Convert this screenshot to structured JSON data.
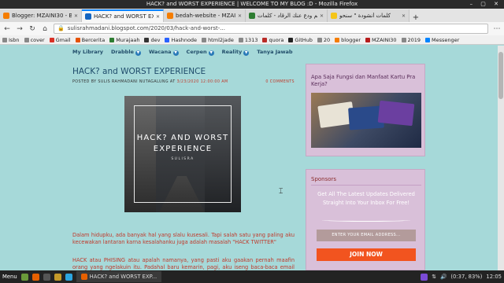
{
  "window": {
    "title": "HACK? and WORST EXPERIENCE | WELCOME TO MY BLOG :D - Mozilla Firefox",
    "controls": "– ▢ ✕"
  },
  "tabs": [
    {
      "label": "Blogger: MZAINI30 - Blo",
      "color": "#f57d00"
    },
    {
      "label": "HACK? and WORST EXP",
      "color": "#1565c0",
      "active": true
    },
    {
      "label": "bedah-website - MZAIN",
      "color": "#f57d00"
    },
    {
      "label": "قم ودع عنك الرقاد - كلمات",
      "color": "#2e7d32"
    },
    {
      "label": "كلمات أنشودة \" سنحو",
      "color": "#f5c518"
    }
  ],
  "nav": {
    "back": "←",
    "forward": "→",
    "reload": "↻",
    "home": "⌂",
    "url": "sulisrahmadani.blogspot.com/2020/03/hack-and-worst-...",
    "menu": "⋯"
  },
  "bookmarks": [
    {
      "label": "Isbn",
      "color": "#888"
    },
    {
      "label": "cover",
      "color": "#888"
    },
    {
      "label": "Gmail",
      "color": "#d93025"
    },
    {
      "label": "Bercerita",
      "color": "#e65100"
    },
    {
      "label": "Murajaah",
      "color": "#2e7d32"
    },
    {
      "label": "dev",
      "color": "#333"
    },
    {
      "label": "Hashnode",
      "color": "#2962ff"
    },
    {
      "label": "html2jade",
      "color": "#888"
    },
    {
      "label": "1313",
      "color": "#888"
    },
    {
      "label": "quora",
      "color": "#b92b27"
    },
    {
      "label": "GitHub",
      "color": "#222"
    },
    {
      "label": "20",
      "color": "#888"
    },
    {
      "label": "blogger",
      "color": "#f57d00"
    },
    {
      "label": "MZAINI30",
      "color": "#b71c1c"
    },
    {
      "label": "2019",
      "color": "#888"
    },
    {
      "label": "Messenger",
      "color": "#0084ff"
    }
  ],
  "blog": {
    "menu": [
      {
        "label": "My Library",
        "dropdown": false
      },
      {
        "label": "Drabble",
        "dropdown": true
      },
      {
        "label": "Wacana",
        "dropdown": true
      },
      {
        "label": "Cerpen",
        "dropdown": true
      },
      {
        "label": "Reality",
        "dropdown": true
      },
      {
        "label": "Tanya Jawab",
        "dropdown": false
      }
    ],
    "dropdown_glyph": "▼",
    "post": {
      "title": "HACK? and WORST EXPERIENCE",
      "meta_author": "POSTED BY SULIS RAHMADANI NUTAGALUNG AT",
      "meta_date": "3/23/2020 12:00:00 AM",
      "comments": "0 COMMENTS",
      "image_line1": "HACK? AND WORST",
      "image_line2": "EXPERIENCE",
      "image_credit": "SULISRA",
      "para1": "Dalam hidupku, ada banyak hal yang slalu kusesali. Tapi salah satu yang paling aku kecewakan lantaran karna kesalahanku juga adalah masalah \"HACK TWITTER\"",
      "para2": "HACK atau PHISING atau apalah namanya, yang pasti aku gaakan pernah maafin orang yang ngelakuin itu. Padahal baru kemarin, pagi, aku iseng baca-baca email dan"
    }
  },
  "sidebar": {
    "card1_title": "Apa Saja Fungsi dan Manfaat Kartu Pra Kerja?",
    "card2_title": "Sponsors",
    "promo": "Get All The Latest Updates Delivered Straight Into Your Inbox For Free!",
    "email_placeholder": "ENTER YOUR EMAIL ADDRESS...",
    "join_label": "JOIN NOW"
  },
  "taskbar": {
    "menu": "Menu",
    "task": "HACK? and WORST EXP...",
    "status": "(0:37, 83%)",
    "clock": "12:05"
  }
}
